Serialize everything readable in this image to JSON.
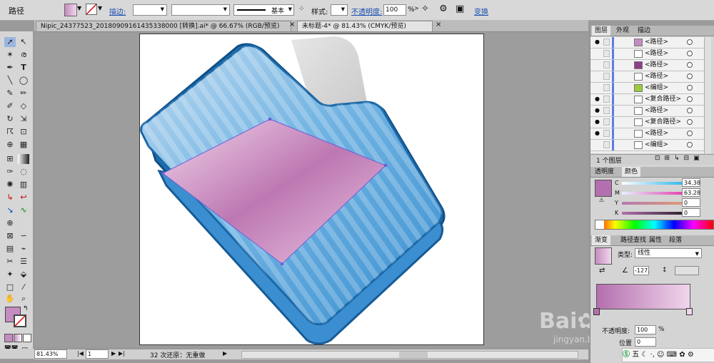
{
  "control_bar": {
    "object_type": "路径",
    "stroke_label": "描边:",
    "stroke_profile": "基本",
    "style_label": "样式:",
    "opacity_label": "不透明度:",
    "opacity_value": "100",
    "opacity_unit": "%",
    "transform_label": "变换"
  },
  "tabs": [
    {
      "label": "Nipic_24377523_20180909161435338000 [转换].ai* @ 66.67% (RGB/预览)"
    },
    {
      "label": "未标题-4* @ 81.43% (CMYK/预览)"
    }
  ],
  "status": {
    "zoom": "81.43%",
    "page": "1",
    "undo_text": "32 次还原：无重做"
  },
  "layers_panel": {
    "tabs": [
      "图层",
      "外观",
      "描边"
    ],
    "rows": [
      {
        "name": "<路径>",
        "visible": true,
        "thumb": "#c58cc0"
      },
      {
        "name": "<路径>",
        "visible": false,
        "thumb": "#ffffff"
      },
      {
        "name": "<路径>",
        "visible": false,
        "thumb": "#8c3f85"
      },
      {
        "name": "<路径>",
        "visible": false,
        "thumb": "#ffffff"
      },
      {
        "name": "<编组>",
        "visible": false,
        "thumb": "#9ccc3a"
      },
      {
        "name": "<复合路径>",
        "visible": true,
        "thumb": "#ffffff"
      },
      {
        "name": "<路径>",
        "visible": true,
        "thumb": "#ffffff"
      },
      {
        "name": "<复合路径>",
        "visible": true,
        "thumb": "#ffffff"
      },
      {
        "name": "<路径>",
        "visible": true,
        "thumb": "#ffffff"
      },
      {
        "name": "<编组>",
        "visible": false,
        "thumb": "#ffffff"
      }
    ],
    "footer": "1 个图层"
  },
  "color_panel": {
    "tabs": [
      "透明度",
      "颜色"
    ],
    "channels": [
      {
        "name": "C",
        "value": "34.38"
      },
      {
        "name": "M",
        "value": "63.28"
      },
      {
        "name": "Y",
        "value": "0"
      },
      {
        "name": "K",
        "value": "0"
      }
    ],
    "fill_color": "#b46fae"
  },
  "gradient_panel": {
    "tabs": [
      "渐变",
      "路径查找",
      "属性",
      "段落"
    ],
    "type_label": "类型:",
    "type_value": "线性",
    "angle_value": "-127.",
    "opacity_label": "不透明度:",
    "opacity_value": "100",
    "opacity_unit": "%",
    "location_label": "位置",
    "location_value": "0"
  },
  "colors": {
    "accent": "#c58cc0",
    "folder_blue": "#2f86c2",
    "path_purple": "#b56aa9"
  }
}
